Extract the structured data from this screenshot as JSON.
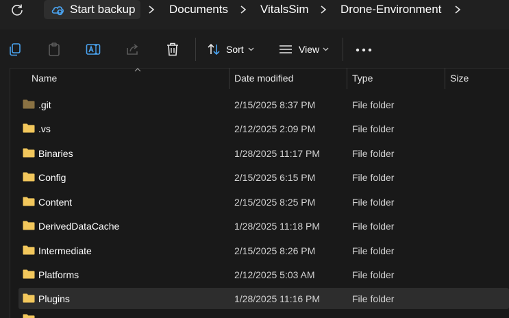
{
  "address_bar": {
    "refresh_icon": "refresh-icon",
    "start_backup_label": "Start backup",
    "breadcrumbs": [
      "Documents",
      "VitalsSim",
      "Drone-Environment"
    ]
  },
  "command_bar": {
    "sort_label": "Sort",
    "view_label": "View",
    "icons": [
      "copy-icon",
      "paste-icon",
      "rename-icon",
      "share-icon",
      "delete-icon",
      "sort-icon",
      "view-icon",
      "more-icon"
    ]
  },
  "columns": {
    "name": "Name",
    "date": "Date modified",
    "type": "Type",
    "size": "Size"
  },
  "files": [
    {
      "name": ".git",
      "date": "2/15/2025 8:37 PM",
      "type": "File folder",
      "hidden": true
    },
    {
      "name": ".vs",
      "date": "2/12/2025 2:09 PM",
      "type": "File folder"
    },
    {
      "name": "Binaries",
      "date": "1/28/2025 11:17 PM",
      "type": "File folder"
    },
    {
      "name": "Config",
      "date": "2/15/2025 6:15 PM",
      "type": "File folder"
    },
    {
      "name": "Content",
      "date": "2/15/2025 8:25 PM",
      "type": "File folder"
    },
    {
      "name": "DerivedDataCache",
      "date": "1/28/2025 11:18 PM",
      "type": "File folder"
    },
    {
      "name": "Intermediate",
      "date": "2/15/2025 8:26 PM",
      "type": "File folder"
    },
    {
      "name": "Platforms",
      "date": "2/12/2025 5:03 AM",
      "type": "File folder"
    },
    {
      "name": "Plugins",
      "date": "1/28/2025 11:16 PM",
      "type": "File folder",
      "selected": true
    }
  ],
  "colors": {
    "background": "#191919",
    "folder": "#f2c75c",
    "folder_hidden": "#8a7243",
    "selected_row": "#2d2d2d",
    "accent": "#4aa3f0"
  }
}
